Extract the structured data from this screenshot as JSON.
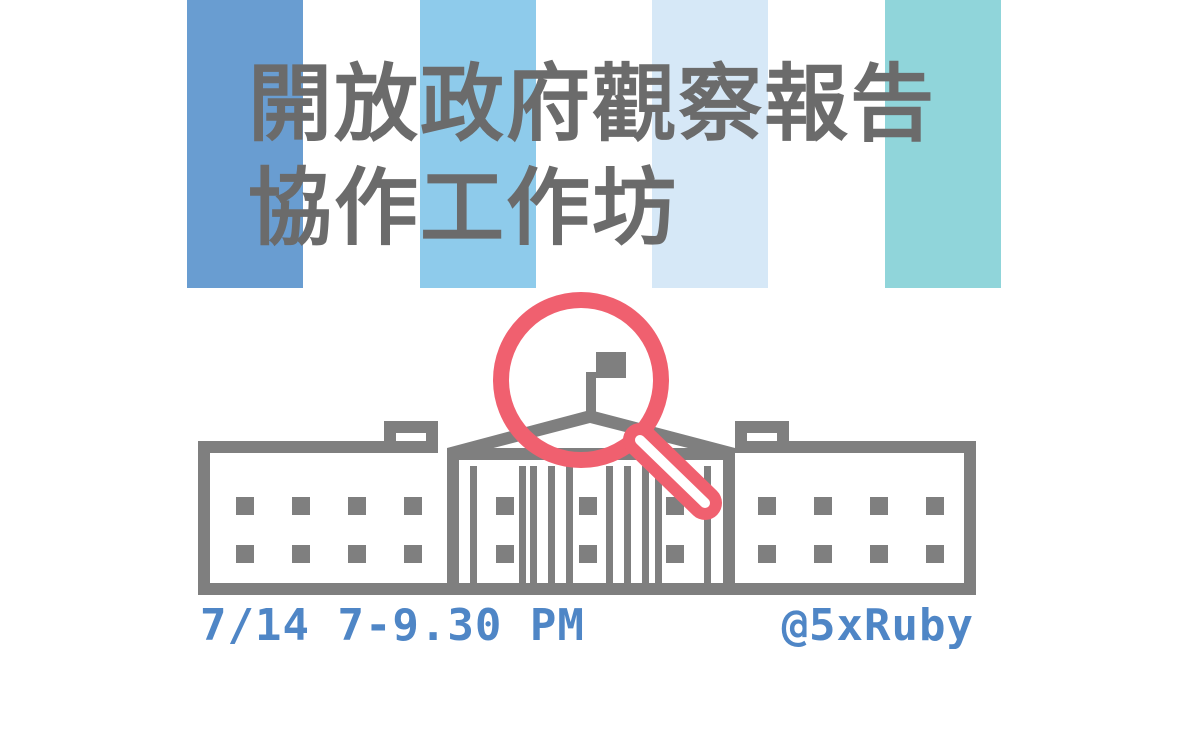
{
  "title": {
    "line1": "開放政府觀察報告",
    "line2": "協作工作坊"
  },
  "event": {
    "datetime": "7/14 7-9.30 PM",
    "venue": "@5xRuby"
  },
  "colors": {
    "stripes": [
      "#699dd1",
      "#8ecbeb",
      "#d6e8f7",
      "#90d5da"
    ],
    "title_text": "#6b6b6b",
    "building": "#7f7f7f",
    "magnifier": "#f0606f",
    "accent_text": "#4f86c6"
  },
  "icons": {
    "building": "government-building-icon",
    "magnifier": "magnifying-glass-icon"
  }
}
